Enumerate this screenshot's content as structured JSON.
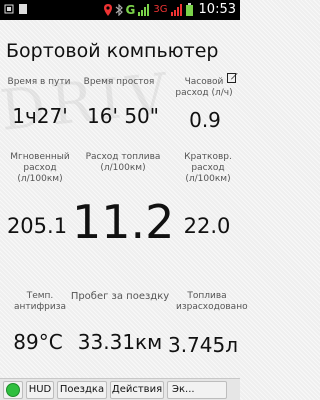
{
  "status_bar": {
    "time": "10:53",
    "network_g": "G",
    "network_3g": "3G"
  },
  "title": "Бортовой компьютер",
  "watermark": "DRIV",
  "row1": {
    "labels": [
      "Время в пути",
      "Время простоя",
      "Часовой расход (л/ч)"
    ],
    "values": [
      "1ч27'",
      "16' 50\"",
      "0.9"
    ]
  },
  "row2": {
    "labels": [
      "Мгновенный расход (л/100км)",
      "Расход топлива (л/100км)",
      "Кратковр. расход (л/100км)"
    ],
    "values": [
      "205.1",
      "11.2",
      "22.0"
    ]
  },
  "row3": {
    "labels": [
      "Темп. антифриза",
      "Пробег за поездку",
      "Топлива израсходовано"
    ],
    "values": [
      "89°C",
      "33.31км",
      "3.745л"
    ]
  },
  "bottom_bar": {
    "buttons": [
      "HUD",
      "Поездка",
      "Действия",
      "Эк..."
    ]
  }
}
